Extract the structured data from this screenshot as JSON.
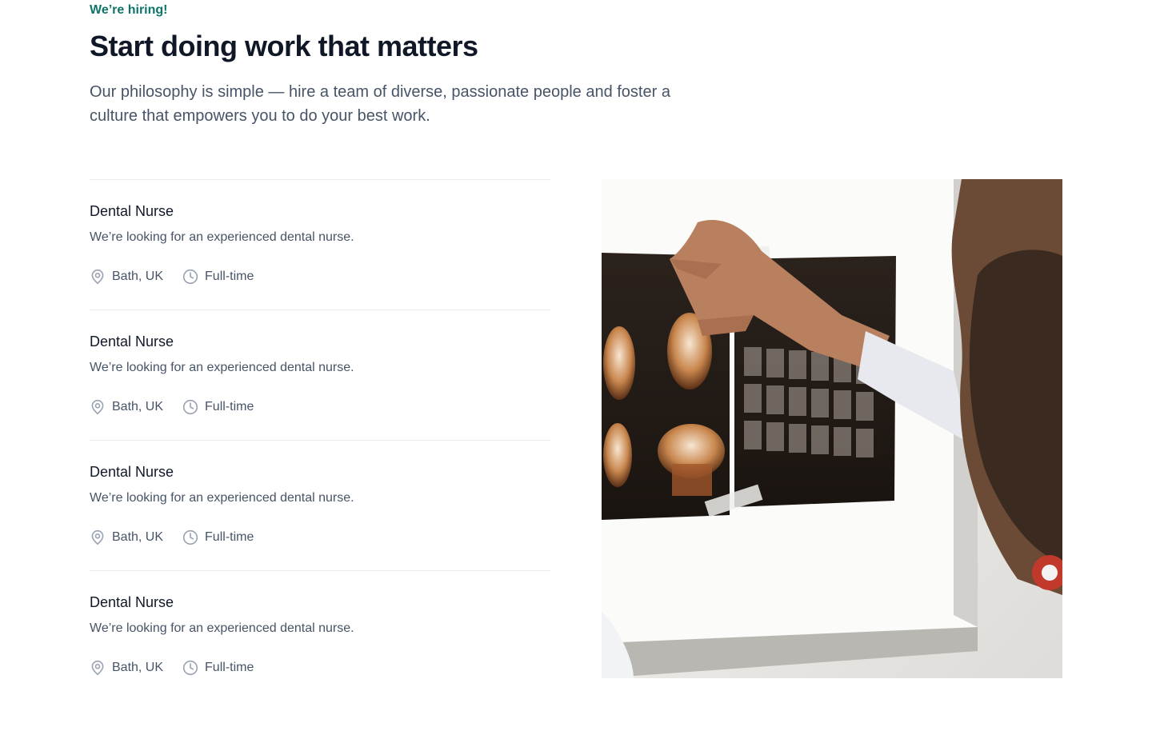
{
  "header": {
    "eyebrow": "We’re hiring!",
    "title": "Start doing work that matters",
    "subtitle": "Our philosophy is simple — hire a team of diverse, passionate people and foster a culture that empowers you to do your best work."
  },
  "jobs": [
    {
      "title": "Dental Nurse",
      "description": "We’re looking for an experienced dental nurse.",
      "location": "Bath, UK",
      "type": "Full-time"
    },
    {
      "title": "Dental Nurse",
      "description": "We’re looking for an experienced dental nurse.",
      "location": "Bath, UK",
      "type": "Full-time"
    },
    {
      "title": "Dental Nurse",
      "description": "We’re looking for an experienced dental nurse.",
      "location": "Bath, UK",
      "type": "Full-time"
    },
    {
      "title": "Dental Nurse",
      "description": "We’re looking for an experienced dental nurse.",
      "location": "Bath, UK",
      "type": "Full-time"
    }
  ],
  "icons": {
    "location": "map-pin-icon",
    "type": "clock-icon"
  },
  "colors": {
    "accent": "#107569",
    "heading": "#101828",
    "body": "#475467",
    "divider": "#EAECF0"
  }
}
